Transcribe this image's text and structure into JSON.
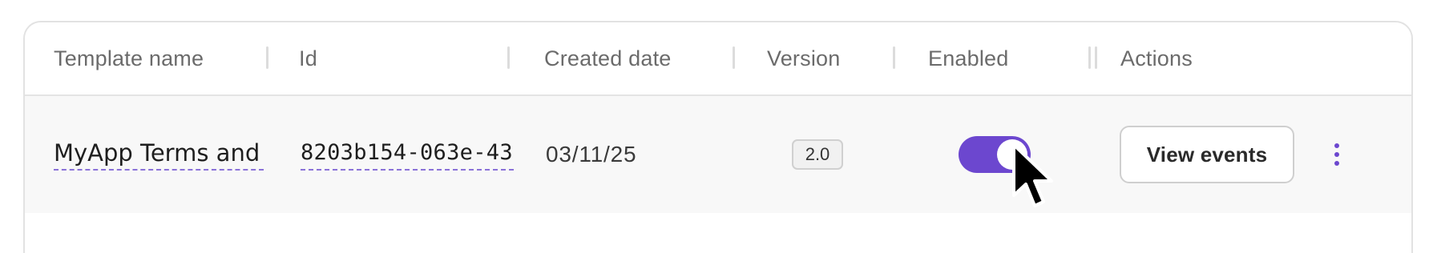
{
  "table": {
    "columns": [
      "Template name",
      "Id",
      "Created date",
      "Version",
      "Enabled",
      "Actions"
    ],
    "rows": [
      {
        "template_name": "MyApp Terms and",
        "id": "8203b154-063e-43",
        "created_date": "03/11/25",
        "version": "2.0",
        "enabled": true,
        "view_events_label": "View events"
      }
    ]
  },
  "icons": {
    "row_menu": "more-vertical-icon",
    "pointer": "mouse-pointer-icon"
  },
  "colors": {
    "accent": "#6c47cf",
    "row_background": "#f8f8f8",
    "header_text": "#6b6b6b",
    "link_underline": "#8a72d8"
  }
}
